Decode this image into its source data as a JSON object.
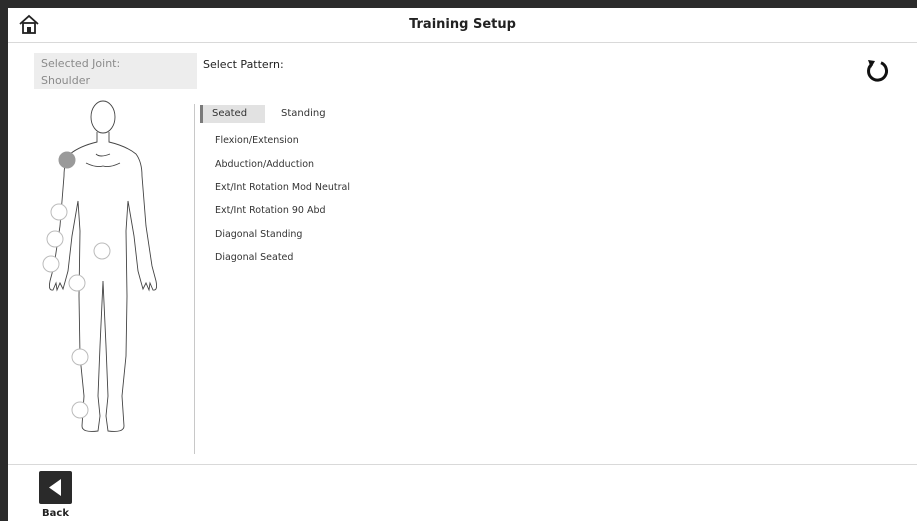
{
  "header": {
    "title": "Training Setup",
    "home_icon": "home-icon"
  },
  "joint": {
    "label": "Selected Joint:",
    "value": "Shoulder"
  },
  "pattern": {
    "label": "Select Pattern:",
    "reset_icon": "reset-icon"
  },
  "tabs": [
    {
      "label": "Seated",
      "selected": true
    },
    {
      "label": "Standing",
      "selected": false
    }
  ],
  "patterns": [
    "Flexion/Extension",
    "Abduction/Adduction",
    "Ext/Int Rotation Mod Neutral",
    "Ext/Int Rotation 90 Abd",
    "Diagonal Standing",
    "Diagonal Seated"
  ],
  "body_joints": [
    {
      "name": "shoulder",
      "selected": true
    },
    {
      "name": "elbow",
      "selected": false
    },
    {
      "name": "forearm",
      "selected": false
    },
    {
      "name": "wrist",
      "selected": false
    },
    {
      "name": "hand",
      "selected": false
    },
    {
      "name": "hip",
      "selected": false
    },
    {
      "name": "knee",
      "selected": false
    },
    {
      "name": "ankle",
      "selected": false
    }
  ],
  "colors": {
    "selected_joint": "#9a9a9a",
    "tab_selected_bg": "#e2e2e2",
    "tab_indicator": "#7a7a7a",
    "back_button": "#2a2a2a"
  },
  "footer": {
    "back_label": "Back",
    "back_icon": "triangle-left-icon"
  }
}
